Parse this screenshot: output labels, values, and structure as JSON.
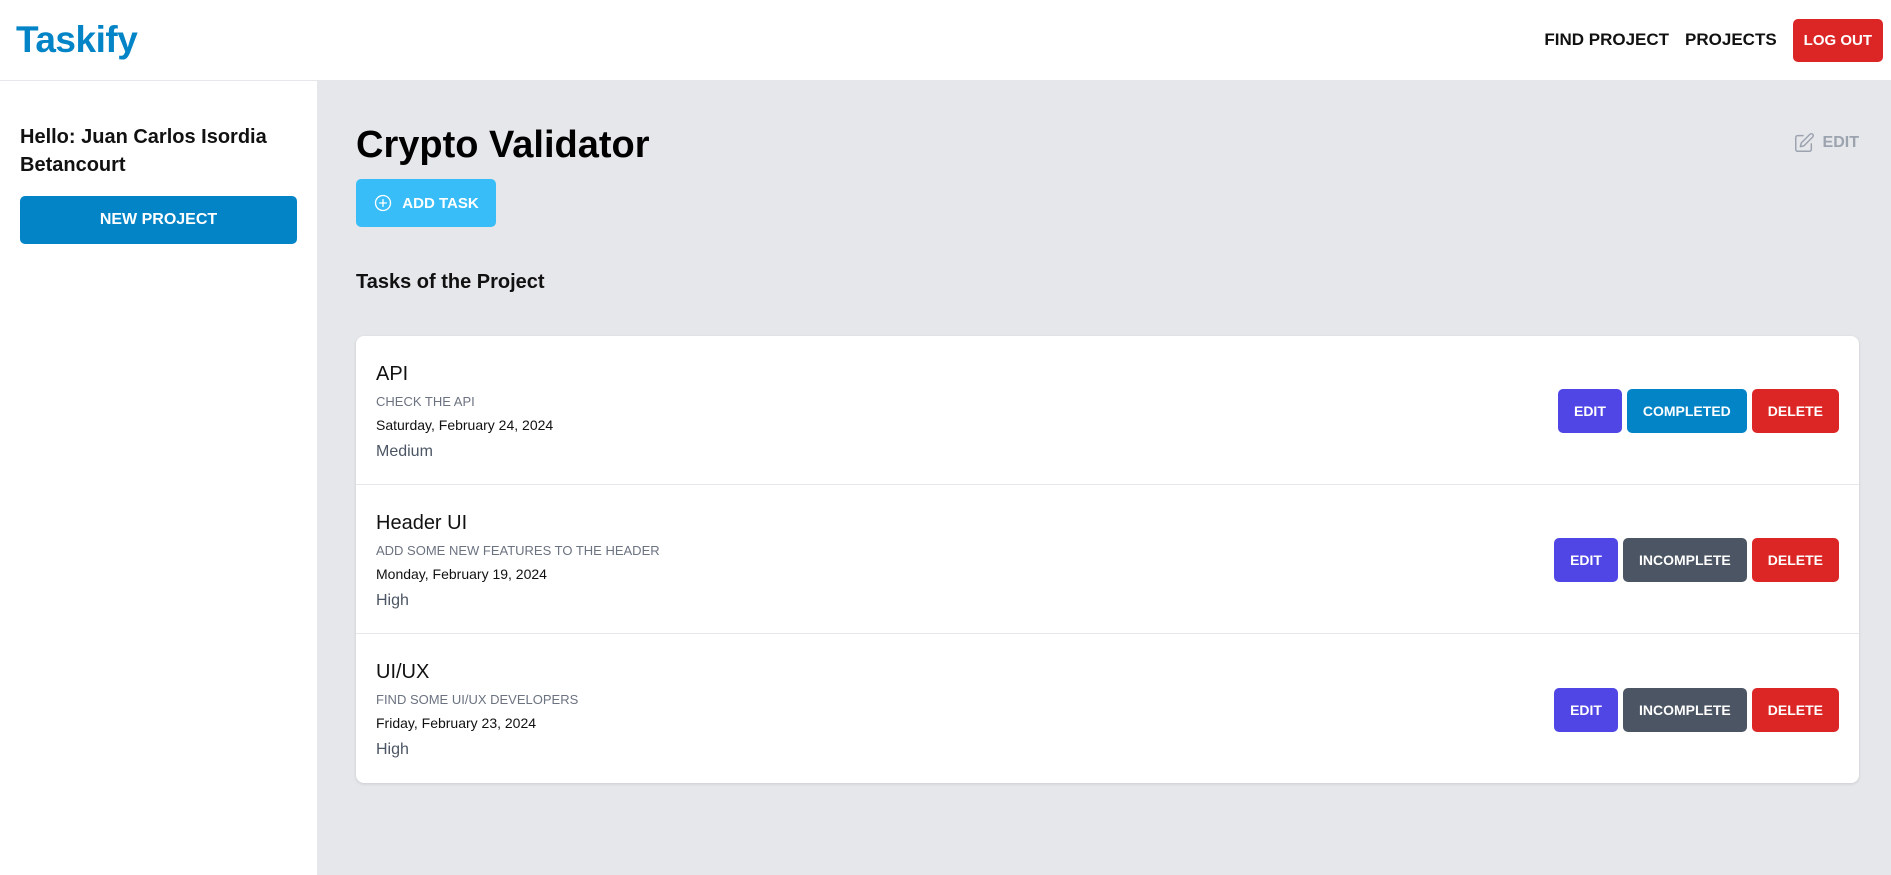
{
  "header": {
    "logo": "Taskify",
    "nav": {
      "find_project": "FIND PROJECT",
      "projects": "PROJECTS",
      "logout": "LOG OUT"
    }
  },
  "sidebar": {
    "greeting": "Hello: Juan Carlos Isordia Betancourt",
    "new_project": "NEW PROJECT"
  },
  "main": {
    "project_title": "Crypto Validator",
    "edit_label": "EDIT",
    "add_task": "ADD TASK",
    "section_title": "Tasks of the Project",
    "tasks": [
      {
        "name": "API",
        "description": "CHECK THE API",
        "date": "Saturday, February 24, 2024",
        "priority": "Medium",
        "edit": "EDIT",
        "status": "COMPLETED",
        "delete": "DELETE"
      },
      {
        "name": "Header UI",
        "description": "ADD SOME NEW FEATURES TO THE HEADER",
        "date": "Monday, February 19, 2024",
        "priority": "High",
        "edit": "EDIT",
        "status": "INCOMPLETE",
        "delete": "DELETE"
      },
      {
        "name": "UI/UX",
        "description": "FIND SOME UI/UX DEVELOPERS",
        "date": "Friday, February 23, 2024",
        "priority": "High",
        "edit": "EDIT",
        "status": "INCOMPLETE",
        "delete": "DELETE"
      }
    ]
  },
  "colors": {
    "brand": "#0284c7",
    "danger": "#dc2626",
    "edit": "#4f46e5",
    "incomplete": "#4b5563",
    "add_task": "#38bdf8"
  }
}
